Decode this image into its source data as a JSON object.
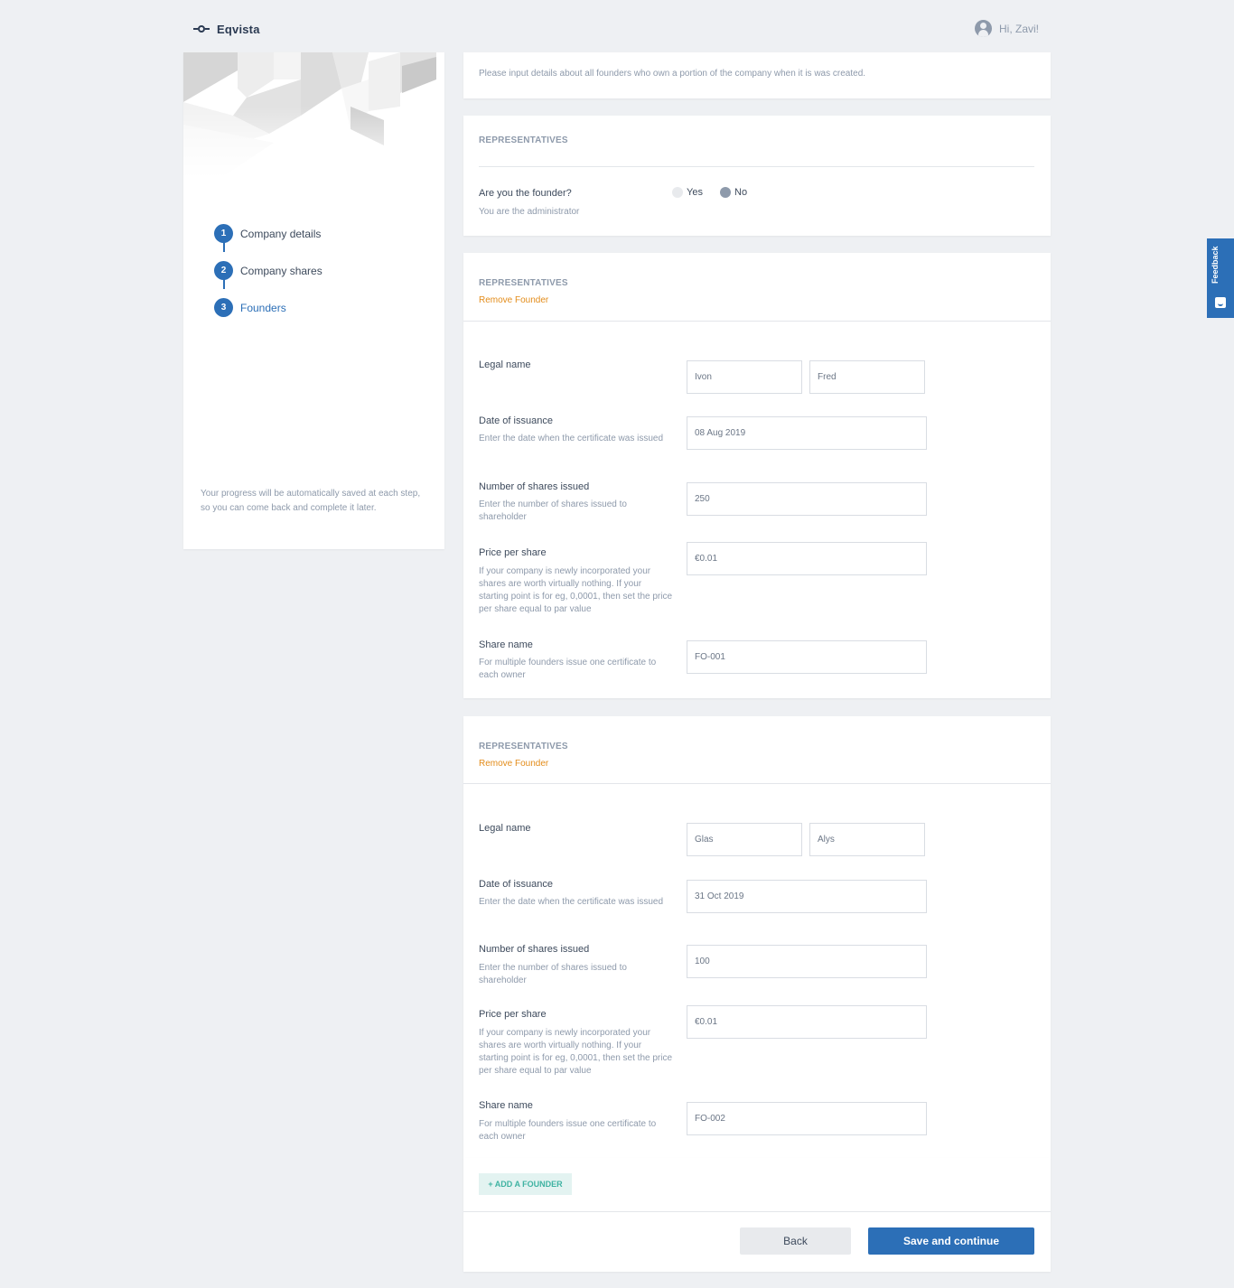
{
  "header": {
    "app_name": "Eqvista",
    "greeting": "Hi, Zavi!"
  },
  "sidebar": {
    "steps": [
      {
        "num": "1",
        "label": "Company details"
      },
      {
        "num": "2",
        "label": "Company shares"
      },
      {
        "num": "3",
        "label": "Founders"
      }
    ],
    "saved_note": "Your progress will be automatically saved at each step, so you can come back and complete it later."
  },
  "intro": {
    "text": "Please input details about all founders who own a portion of the company when it is was created."
  },
  "representatives": {
    "title": "REPRESENTATIVES",
    "question": "Are you the founder?",
    "subtext": "You are the administrator",
    "options": {
      "yes": "Yes",
      "no": "No"
    },
    "selected": "No"
  },
  "labels": {
    "legal_name": "Legal name",
    "date": "Date of issuance",
    "date_help": "Enter the date when the certificate was issued",
    "shares": "Number of shares issued",
    "shares_help": "Enter the number of shares issued to shareholder",
    "price": "Price per share",
    "price_help": "If your company is newly incorporated your shares are worth virtually nothing. If your starting point is for eg, 0,0001, then set the price per share equal to par value",
    "share_name": "Share name",
    "share_name_help": "For multiple founders issue one certificate to each owner"
  },
  "founders": [
    {
      "title": "REPRESENTATIVES",
      "remove": "Remove Founder",
      "first_name": "Ivon",
      "last_name": "Fred",
      "date": "08 Aug 2019",
      "shares": "250",
      "price": "€0.01",
      "share_name": "FO-001"
    },
    {
      "title": "REPRESENTATIVES",
      "remove": "Remove Founder",
      "first_name": "Glas",
      "last_name": "Alys",
      "date": "31 Oct 2019",
      "shares": "100",
      "price": "€0.01",
      "share_name": "FO-002"
    }
  ],
  "actions": {
    "add_founder": "+ ADD A FOUNDER",
    "back": "Back",
    "save": "Save and continue"
  },
  "feedback": {
    "label": "Feedback"
  },
  "colors": {
    "primary": "#2c6fb7",
    "warning": "#e38c1a",
    "accent_teal": "#3fb3a2",
    "background": "#eef0f3"
  }
}
